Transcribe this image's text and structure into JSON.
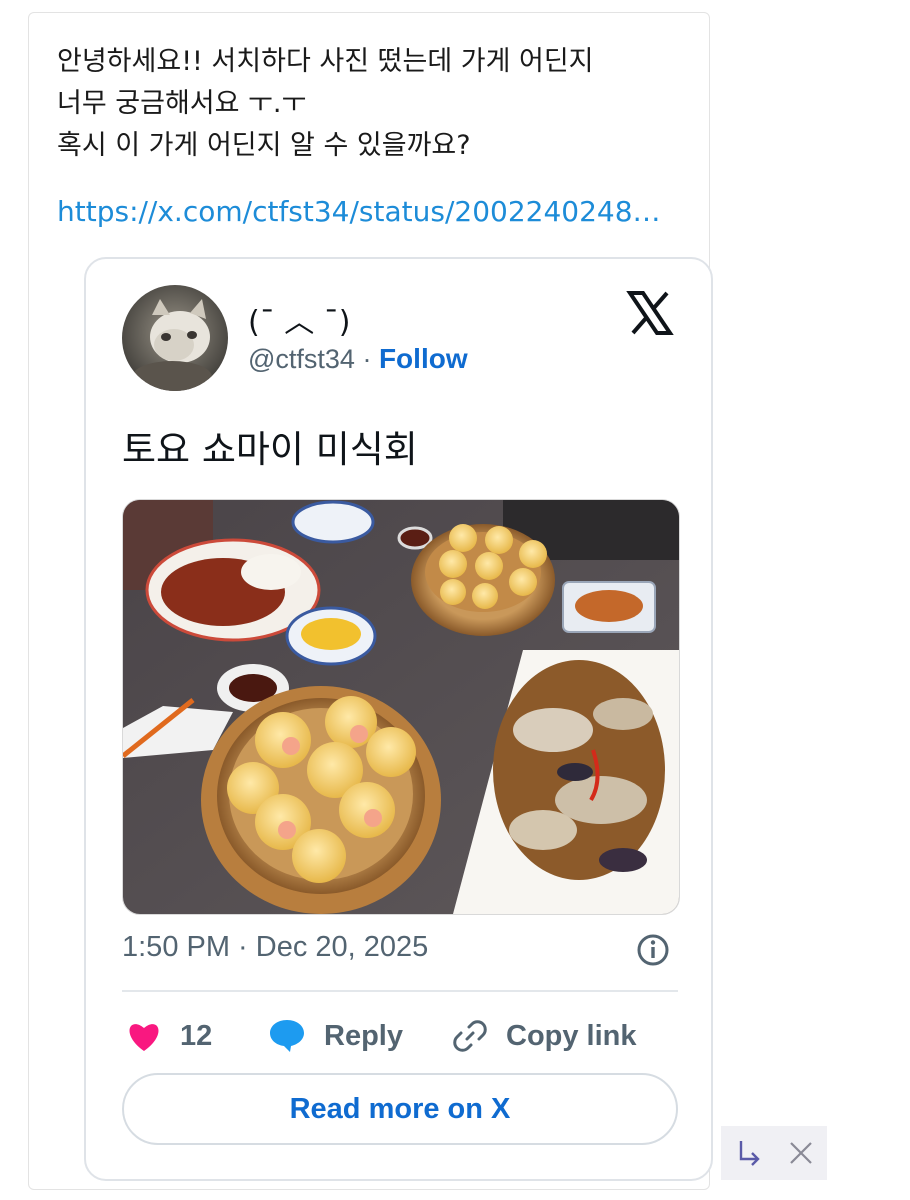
{
  "post": {
    "lines": [
      "안녕하세요!! 서치하다 사진 떴는데 가게 어딘지",
      "너무 궁금해서요 ㅜ.ㅜ",
      "혹시 이 가게 어딘지 알 수 있을까요?"
    ],
    "link": "https://x.com/ctfst34/status/2002240248…"
  },
  "tweet": {
    "display_name": "(¯ ︿ ¯)",
    "handle": "@ctfst34",
    "separator": " · ",
    "follow_label": "Follow",
    "text": "토요 쇼마이 미식회",
    "timestamp": "1:50 PM · Dec 20, 2025",
    "likes": "12",
    "reply_label": "Reply",
    "copy_link_label": "Copy link",
    "read_more_label": "Read more on X"
  },
  "icons": {
    "like": "heart-icon",
    "reply": "speech-bubble-icon",
    "copy": "link-icon",
    "info": "info-icon",
    "logo": "x-logo-icon",
    "reply_arrow": "reply-arrow-icon",
    "close": "close-icon"
  },
  "colors": {
    "link": "#1d8cd8",
    "accent": "#0f6bd0",
    "heart": "#f91880",
    "reply_bubble": "#1d9bf0",
    "muted": "#536471"
  }
}
